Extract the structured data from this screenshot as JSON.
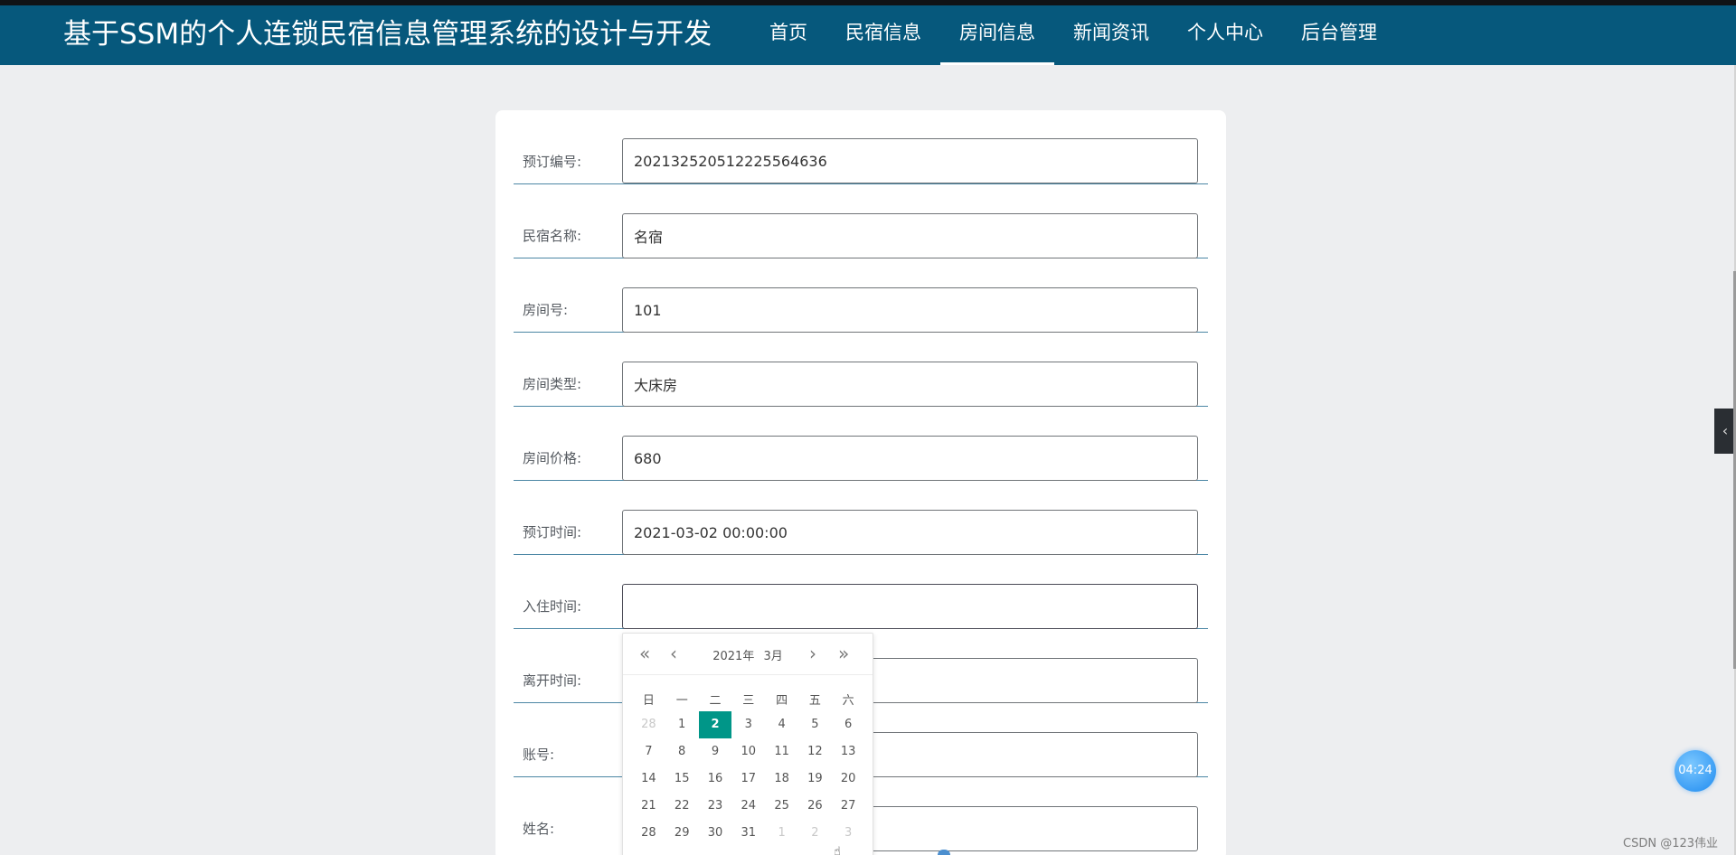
{
  "site": {
    "title": "基于SSM的个人连锁民宿信息管理系统的设计与开发",
    "nav": [
      {
        "label": "首页"
      },
      {
        "label": "民宿信息"
      },
      {
        "label": "房间信息",
        "active": true
      },
      {
        "label": "新闻资讯"
      },
      {
        "label": "个人中心"
      },
      {
        "label": "后台管理"
      }
    ]
  },
  "form": {
    "order_no": {
      "label": "预订编号:",
      "value": "20213252051222556​4636"
    },
    "homestay_name": {
      "label": "民宿名称:",
      "value": "名宿"
    },
    "room_no": {
      "label": "房间号:",
      "value": "101"
    },
    "room_type": {
      "label": "房间类型:",
      "value": "大床房"
    },
    "room_price": {
      "label": "房间价格:",
      "value": "680"
    },
    "booking_time": {
      "label": "预订时间:",
      "value": "2021-03-02 00:00:00"
    },
    "checkin_time": {
      "label": "入住时间:",
      "value": ""
    },
    "checkout_time": {
      "label": "离开时间:",
      "value": ""
    },
    "account": {
      "label": "账号:",
      "value": ""
    },
    "name": {
      "label": "姓名:",
      "value": ""
    }
  },
  "calendar": {
    "year": "2021年",
    "month": "3月",
    "prev_year_icon": "«",
    "prev_month_icon": "‹",
    "next_month_icon": "›",
    "next_year_icon": "»",
    "weekdays": [
      "日",
      "一",
      "二",
      "三",
      "四",
      "五",
      "六"
    ],
    "selected_day": 2,
    "weeks": [
      [
        "28",
        "1",
        "2",
        "3",
        "4",
        "5",
        "6"
      ],
      [
        "7",
        "8",
        "9",
        "10",
        "11",
        "12",
        "13"
      ],
      [
        "14",
        "15",
        "16",
        "17",
        "18",
        "19",
        "20"
      ],
      [
        "21",
        "22",
        "23",
        "24",
        "25",
        "26",
        "27"
      ],
      [
        "28",
        "29",
        "30",
        "31",
        "1",
        "2",
        "3"
      ]
    ]
  },
  "overlay": {
    "side_tab_icon": "‹",
    "clock": "04:24",
    "watermark": "CSDN @123伟业"
  },
  "colors": {
    "header": "#06587c",
    "accent": "#009688"
  }
}
